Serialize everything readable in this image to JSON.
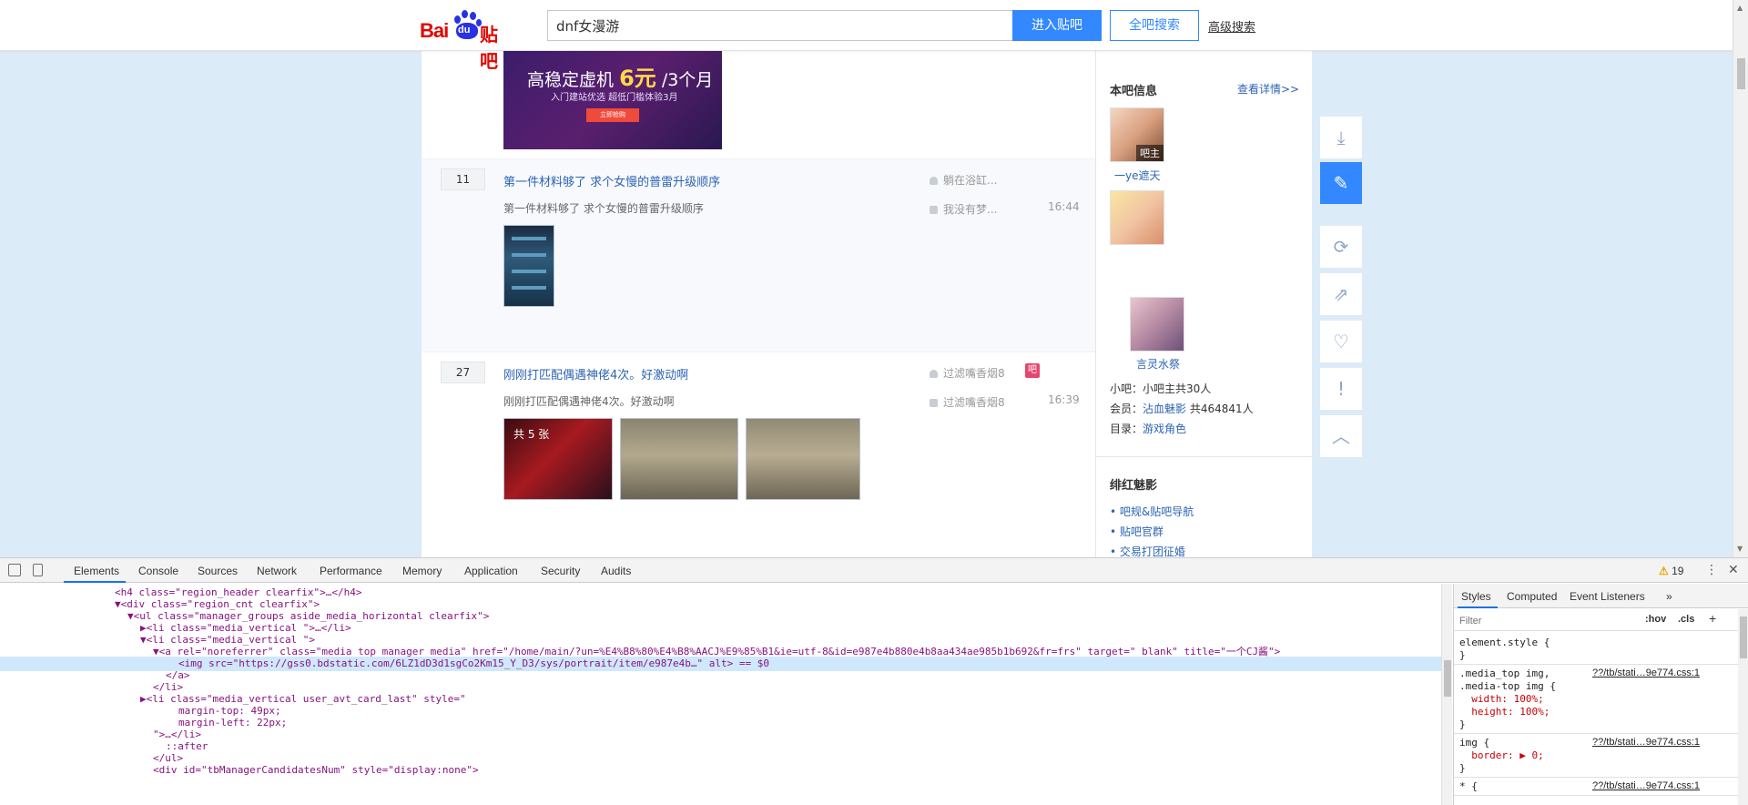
{
  "header": {
    "logo_text": "Baidu贴吧",
    "logo_bai": "Bai",
    "logo_du": "du",
    "logo_tieba": "贴吧",
    "search_value": "dnf女漫游",
    "enter_button": "进入贴吧",
    "search_all_button": "全吧搜索",
    "advanced_link": "高级搜索"
  },
  "ad": {
    "line1_prefix": "高稳定虚机",
    "line1_price": "6元",
    "line1_suffix": "/3个月",
    "line2": "入门建站优选 超低门槛体验3月",
    "cta": "立即抢购"
  },
  "threads": [
    {
      "reply_count": "11",
      "title": "第一件材料够了 求个女慢的普雷升级顺序",
      "abstract": "第一件材料够了 求个女慢的普雷升级顺序",
      "author": "躺在浴缸...",
      "last_replier": "我没有梦...",
      "time": "16:44"
    },
    {
      "reply_count": "27",
      "title": "刚刚打匹配偶遇神佬4次。好激动啊",
      "abstract": "刚刚打匹配偶遇神佬4次。好激动啊",
      "author": "过滤嘴香烟8",
      "last_replier": "过滤嘴香烟8",
      "time": "16:39",
      "badge": "吧",
      "image_count": "共 5 张"
    }
  ],
  "sidebar": {
    "info_title": "本吧信息",
    "info_more": "查看详情>>",
    "owner_badge": "吧主",
    "owner_name": "一ye遮天",
    "manager_name": "言灵水祭",
    "small_admins": "小吧：小吧主共30人",
    "members_label": "会员：",
    "members_link": "沾血魅影",
    "members_count": "共464841人",
    "category_label": "目录：",
    "category_link": "游戏角色",
    "section2_title": "绯红魅影",
    "links": [
      "吧规&贴吧导航",
      "贴吧官群",
      "交易打团征婚"
    ]
  },
  "right_tools": [
    {
      "name": "download-app",
      "glyph": "⤓"
    },
    {
      "name": "post",
      "glyph": "✎"
    },
    {
      "name": "refresh",
      "glyph": "⟳"
    },
    {
      "name": "share",
      "glyph": "⇗"
    },
    {
      "name": "favorite",
      "glyph": "♡"
    },
    {
      "name": "report",
      "glyph": "!"
    },
    {
      "name": "back-to-top",
      "glyph": "︿"
    }
  ],
  "devtools": {
    "tabs": [
      "Elements",
      "Console",
      "Sources",
      "Network",
      "Performance",
      "Memory",
      "Application",
      "Security",
      "Audits"
    ],
    "selected_tab": "Elements",
    "warnings": "19",
    "code_lines": [
      {
        "text": "<h4 class=\"region_header clearfix\">…</h4>",
        "indent": 18
      },
      {
        "text": "▼<div class=\"region_cnt clearfix\">",
        "indent": 18
      },
      {
        "text": "▼<ul class=\"manager_groups aside_media_horizontal clearfix\">",
        "indent": 20
      },
      {
        "text": "▶<li class=\"media_vertical \">…</li>",
        "indent": 22
      },
      {
        "text": "▼<li class=\"media_vertical \">",
        "indent": 22
      },
      {
        "text": "▼<a rel=\"noreferrer\" class=\"media_top manager_media\" href=\"/home/main/?un=%E4%B8%80%E4%B8%AACJ%E9%85%B1&ie=utf-8&id=e987e4b880e4b8aa434ae985b1b692&fr=frs\" target=\"_blank\" title=\"一个CJ酱\">",
        "indent": 24
      },
      {
        "text": "<img src=\"https://gss0.bdstatic.com/6LZ1dD3d1sgCo2Km15_Y_D3/sys/portrait/item/e987e4b…\" alt> == $0",
        "indent": 28,
        "highlight": true
      },
      {
        "text": "</a>",
        "indent": 26
      },
      {
        "text": "</li>",
        "indent": 24
      },
      {
        "text": "▶<li class=\"media_vertical user_avt_card_last\" style=\"",
        "indent": 22
      },
      {
        "text": "margin-top: 49px;",
        "indent": 28
      },
      {
        "text": "margin-left: 22px;",
        "indent": 28
      },
      {
        "text": "\">…</li>",
        "indent": 24
      },
      {
        "text": "::after",
        "indent": 26
      },
      {
        "text": "</ul>",
        "indent": 24
      },
      {
        "text": "<div id=\"tbManagerCandidatesNum\" style=\"display:none\">",
        "indent": 24
      }
    ],
    "styles_tabs": [
      "Styles",
      "Computed",
      "Event Listeners",
      "»"
    ],
    "filter_placeholder": "Filter",
    "hov": ":hov",
    "cls": ".cls",
    "plus": "+",
    "rules": [
      {
        "lines": [
          "element.style {",
          "}"
        ],
        "source": ""
      },
      {
        "lines": [
          ".media_top img,",
          ".media-top img {",
          "  width: 100%;",
          "  height: 100%;",
          "}"
        ],
        "source": "??/tb/stati…9e774.css:1"
      },
      {
        "lines": [
          "img {",
          "  border: ▶ 0;",
          "}"
        ],
        "source": "??/tb/stati…9e774.css:1"
      },
      {
        "lines": [
          "* {"
        ],
        "source": "??/tb/stati…9e774.css:1"
      }
    ]
  }
}
